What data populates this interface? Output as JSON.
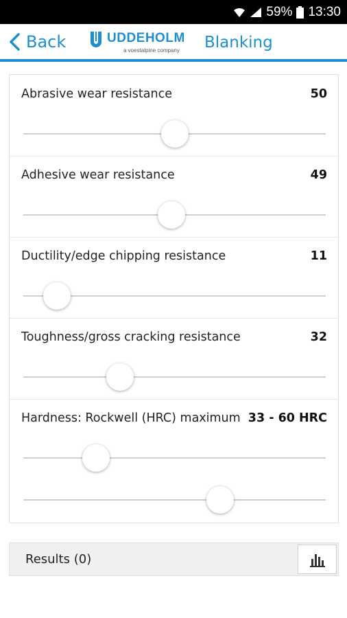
{
  "status_bar": {
    "battery_percent": "59%",
    "time": "13:30"
  },
  "header": {
    "back_label": "Back",
    "logo_word": "UDDEHOLM",
    "logo_tagline": "a voestalpine company",
    "title": "Blanking",
    "accent_color": "#1d8fd0"
  },
  "filters": [
    {
      "label": "Abrasive wear resistance",
      "value_text": "50",
      "level": 0.5
    },
    {
      "label": "Adhesive wear resistance",
      "value_text": "49",
      "level": 0.49
    },
    {
      "label": "Ductility/edge chipping resistance",
      "value_text": "11",
      "level": 0.11
    },
    {
      "label": "Toughness/gross cracking resistance",
      "value_text": "32",
      "level": 0.32
    }
  ],
  "hardness": {
    "label": "Hardness: Rockwell (HRC) maximum",
    "value_text": "33 - 60 HRC",
    "min_level": 0.24,
    "max_level": 0.65
  },
  "results": {
    "label": "Results (0)",
    "icon": "bar-chart-icon"
  }
}
